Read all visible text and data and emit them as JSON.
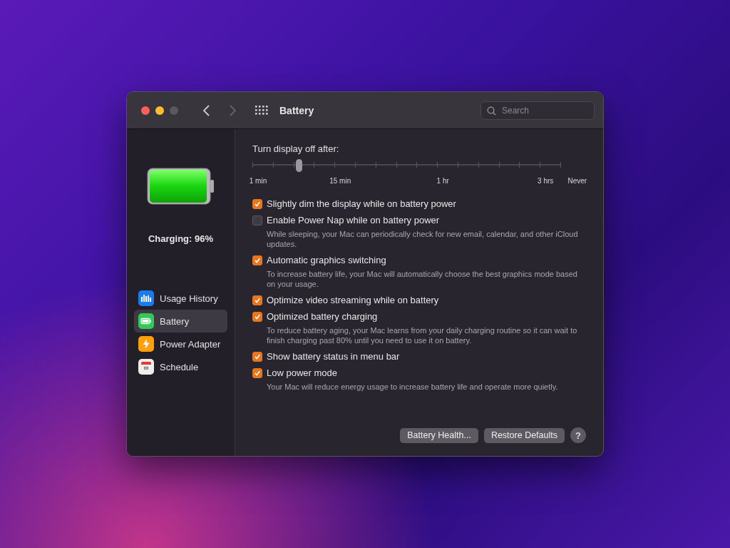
{
  "window": {
    "title": "Battery",
    "search": {
      "placeholder": "Search"
    }
  },
  "sidebar": {
    "status": "Charging: 96%",
    "items": [
      {
        "label": "Usage History",
        "selected": false
      },
      {
        "label": "Battery",
        "selected": true
      },
      {
        "label": "Power Adapter",
        "selected": false
      },
      {
        "label": "Schedule",
        "selected": false
      }
    ]
  },
  "display_off": {
    "label": "Turn display off after:",
    "level": 0.15,
    "tick_labels": [
      "1 min",
      "15 min",
      "1 hr",
      "3 hrs",
      "Never"
    ]
  },
  "options": [
    {
      "label": "Slightly dim the display while on battery power",
      "checked": true
    },
    {
      "label": "Enable Power Nap while on battery power",
      "checked": false,
      "description": "While sleeping, your Mac can periodically check for new email, calendar, and other iCloud updates."
    },
    {
      "label": "Automatic graphics switching",
      "checked": true,
      "description": "To increase battery life, your Mac will automatically choose the best graphics mode based on your usage."
    },
    {
      "label": "Optimize video streaming while on battery",
      "checked": true
    },
    {
      "label": "Optimized battery charging",
      "checked": true,
      "description": "To reduce battery aging, your Mac learns from your daily charging routine so it can wait to finish charging past 80% until you need to use it on battery."
    },
    {
      "label": "Show battery status in menu bar",
      "checked": true
    },
    {
      "label": "Low power mode",
      "checked": true,
      "description": "Your Mac will reduce energy usage to increase battery life and operate more quietly."
    }
  ],
  "buttons": [
    {
      "label": "Battery Health..."
    },
    {
      "label": "Restore Defaults"
    },
    {
      "label": "?",
      "kind": "help"
    }
  ]
}
